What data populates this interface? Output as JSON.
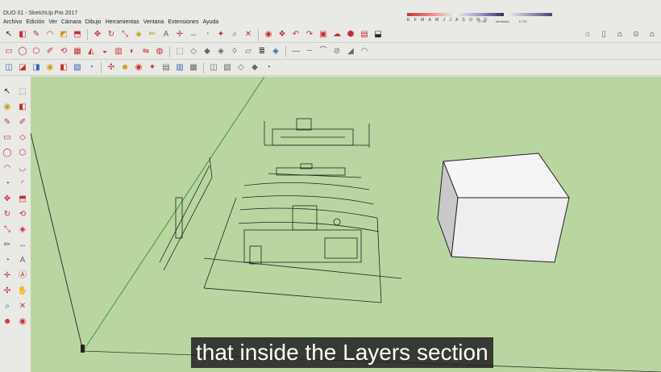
{
  "window": {
    "title": "DUO 01 - SketchUp Pro 2017"
  },
  "menu": [
    "Archivo",
    "Edición",
    "Ver",
    "Cámara",
    "Dibujo",
    "Herramientas",
    "Ventana",
    "Extensiones",
    "Ayuda"
  ],
  "shadow": {
    "months": "E F M A M J J A S O N D",
    "time_start": "07:35",
    "time_mid": "Mediodía",
    "time_end": "17:33"
  },
  "caption": "that inside the Layers section",
  "icons": {
    "toolbar_row1": [
      "select",
      "eraser",
      "pencil",
      "arc",
      "shape",
      "pushpull",
      "move",
      "rotate",
      "scale",
      "offset",
      "tape",
      "text",
      "axes",
      "dimension",
      "protractor",
      "section",
      "search",
      "zoom-extents",
      "paint",
      "components",
      "undo",
      "redo",
      "print",
      "cloud",
      "warehouse",
      "box"
    ],
    "toolbar_row2": [
      "rectangle",
      "circle",
      "polygon",
      "freehand",
      "follow-me",
      "sandbox",
      "terrain",
      "smoove",
      "stamp",
      "drape",
      "flip",
      "materials",
      "display-style",
      "hidden-line",
      "shaded",
      "textured",
      "monochrome",
      "xray",
      "back-edges",
      "wireframe"
    ],
    "toolbar_row3": [
      "iso",
      "top",
      "front",
      "right",
      "back",
      "left",
      "bottom",
      "camera",
      "walk",
      "look",
      "position",
      "section-plane",
      "section-cut",
      "section-fill"
    ],
    "right_icons": [
      "house-icon",
      "document-icon",
      "home-icon",
      "person-icon"
    ]
  }
}
